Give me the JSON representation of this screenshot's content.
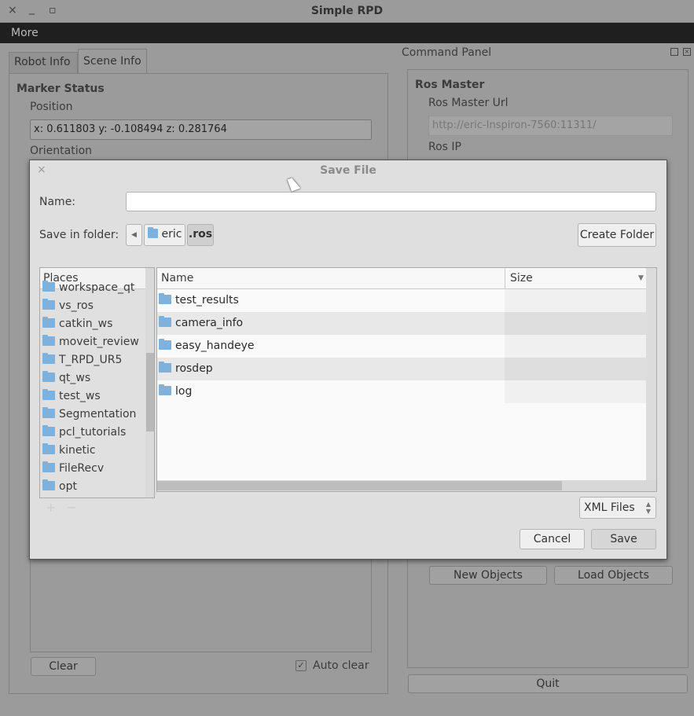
{
  "window": {
    "title": "Simple RPD",
    "close": "×",
    "minimize": "_",
    "maximize": "▫"
  },
  "menu": {
    "items": [
      "More"
    ]
  },
  "left": {
    "tabs": [
      "Robot Info",
      "Scene Info"
    ],
    "marker_status": "Marker Status",
    "position_label": "Position",
    "position_value": "x: 0.611803 y: -0.108494 z: 0.281764",
    "orientation_label": "Orientation",
    "clear": "Clear",
    "auto_clear": "Auto clear",
    "auto_clear_checked": true
  },
  "right": {
    "title": "Command Panel",
    "ros_master": "Ros Master",
    "ros_master_url_label": "Ros Master Url",
    "ros_master_url": "http://eric-Inspiron-7560:11311/",
    "ros_ip_label": "Ros IP",
    "new_objects": "New Objects",
    "load_objects": "Load Objects",
    "quit": "Quit"
  },
  "dialog": {
    "title": "Save File",
    "close": "×",
    "name_label": "Name:",
    "name_value": "",
    "save_in_label": "Save in folder:",
    "path": [
      "eric",
      ".ros"
    ],
    "create_folder": "Create Folder",
    "places_header": "Places",
    "places": [
      "workspace_qt",
      "vs_ros",
      "catkin_ws",
      "moveit_review",
      "T_RPD_UR5",
      "qt_ws",
      "test_ws",
      "Segmentation",
      "pcl_tutorials",
      "kinetic",
      "FileRecv",
      "opt"
    ],
    "columns": {
      "name": "Name",
      "size": "Size"
    },
    "files": [
      "test_results",
      "camera_info",
      "easy_handeye",
      "rosdep",
      "log"
    ],
    "filter": "XML Files",
    "cancel": "Cancel",
    "save": "Save",
    "add": "+",
    "remove": "−"
  },
  "colors": {
    "folder": "#7fb1dd",
    "menubar": "#1f1f1f"
  }
}
